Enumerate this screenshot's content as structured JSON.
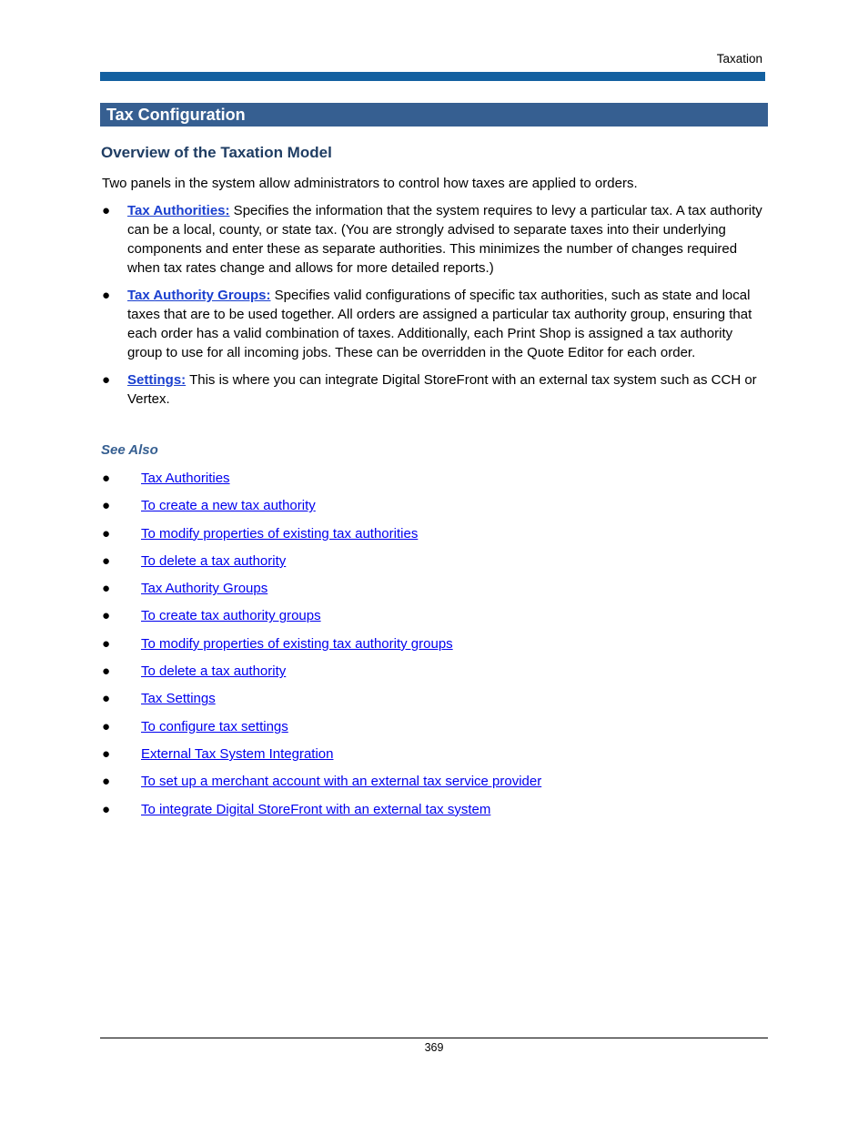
{
  "header": {
    "running_title": "Taxation"
  },
  "section_title": "Tax Configuration",
  "subsection_title": "Overview of the Taxation Model",
  "intro": "Two panels in the system allow administrators to control how taxes are applied to orders.",
  "bullets": [
    {
      "link": "Tax Authorities:",
      "text": " Specifies the information that the system requires to levy a particular tax. A tax authority can be a local, county, or state tax. (You are strongly advised to separate taxes into their underlying components and enter these as separate authorities. This minimizes the number of changes required when tax rates change and allows for more detailed reports.)"
    },
    {
      "link": "Tax Authority Groups:",
      "text": " Specifies valid configurations of specific tax authorities, such as state and local taxes that are to be used together. All orders are assigned a particular tax authority group, ensuring that each order has a valid combination of taxes. Additionally, each Print Shop is assigned a tax authority group to use for all incoming jobs. These can be overridden in the Quote Editor for each order."
    },
    {
      "link": "Settings:",
      "text": " This is where you can integrate Digital StoreFront with an external tax system such as CCH or Vertex."
    }
  ],
  "bullet_glyph": "●",
  "see_also": {
    "heading": "See Also",
    "links": [
      "Tax Authorities",
      "To create a new tax authority",
      "To modify properties of existing tax authorities",
      "To delete a tax authority",
      "Tax Authority Groups",
      "To create tax authority groups",
      "To modify properties of existing tax authority groups",
      "To delete a tax authority",
      "Tax Settings",
      "To configure tax settings",
      "External Tax System Integration",
      "To set up a merchant account with an external tax service provider",
      "To integrate Digital StoreFront with an external tax system"
    ]
  },
  "footer": {
    "page_number": "369"
  }
}
